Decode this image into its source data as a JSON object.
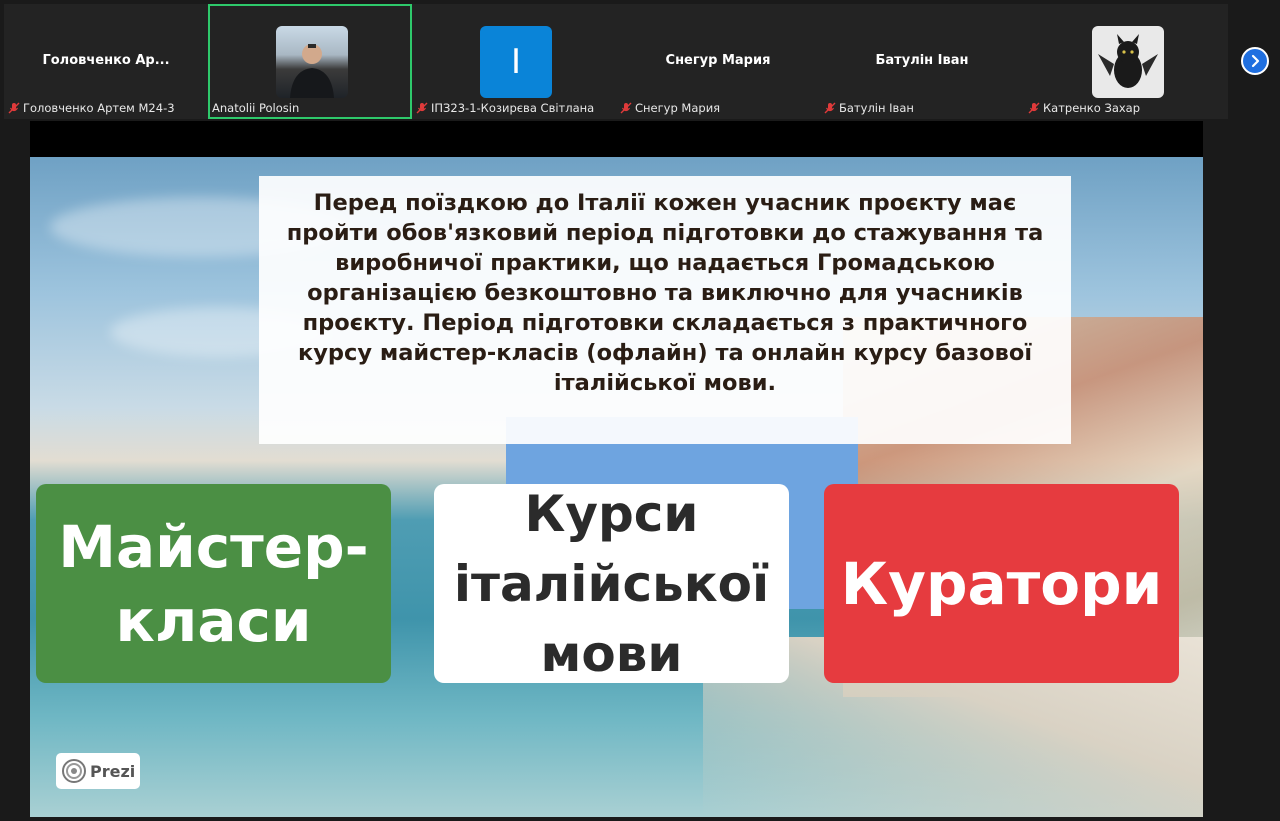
{
  "participants": [
    {
      "display_name": "Головченко  Ар...",
      "label": "Головченко Артем М24-3",
      "muted": true
    },
    {
      "label": "Anatolii Polosin",
      "muted": false,
      "active": true
    },
    {
      "avatar_letter": "I",
      "label": "ІПЗ23-1-Козирєва Світлана",
      "muted": true
    },
    {
      "display_name": "Снегур Мария",
      "label": "Снегур Мария",
      "muted": true
    },
    {
      "display_name": "Батулін Іван",
      "label": "Батулін Іван",
      "muted": true
    },
    {
      "label": "Катренко Захар",
      "muted": true
    }
  ],
  "slide": {
    "paragraph": "Перед поїздкою до Італії кожен учасник проєкту має пройти обов'язковий період підготовки до стажування та виробничої практики, що надається Громадською організацією безкоштовно та виключно для учасників проєкту. Період підготовки складається з практичного курсу майстер-класів (офлайн) та онлайн курсу базової італійської мови.",
    "card_master": "Майстер-класи",
    "card_italian": "Курси італійської мови",
    "card_curators": "Куратори",
    "prezi_label": "Prezi"
  },
  "colors": {
    "active_border": "#2ec96b",
    "green_card": "#4b8f44",
    "red_card": "#e63b3f",
    "blue_block": "#6ea4e0",
    "avatar_blue": "#0a84d8"
  },
  "icons": {
    "mic": "mic-muted-icon",
    "next": "chevron-right-icon",
    "prezi": "prezi-logo-icon"
  }
}
